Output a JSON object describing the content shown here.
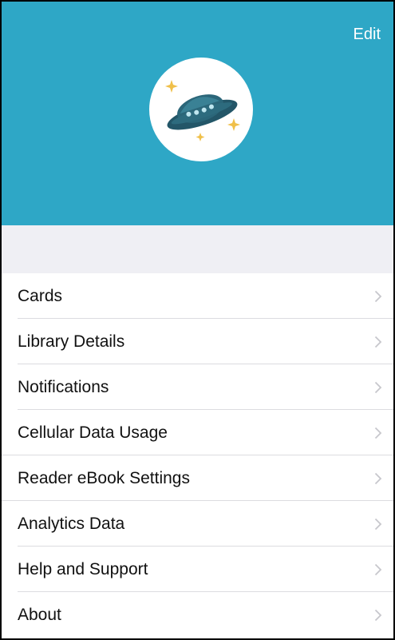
{
  "header": {
    "edit_label": "Edit",
    "background_color": "#2ea7c6",
    "avatar_icon": "ufo-icon"
  },
  "menu": {
    "items": [
      {
        "label": "Cards"
      },
      {
        "label": "Library Details"
      },
      {
        "label": "Notifications"
      },
      {
        "label": "Cellular Data Usage"
      },
      {
        "label": "Reader eBook Settings"
      },
      {
        "label": "Analytics Data"
      },
      {
        "label": "Help and Support"
      },
      {
        "label": "About"
      }
    ],
    "chevron_icon": "chevron-right-icon"
  }
}
